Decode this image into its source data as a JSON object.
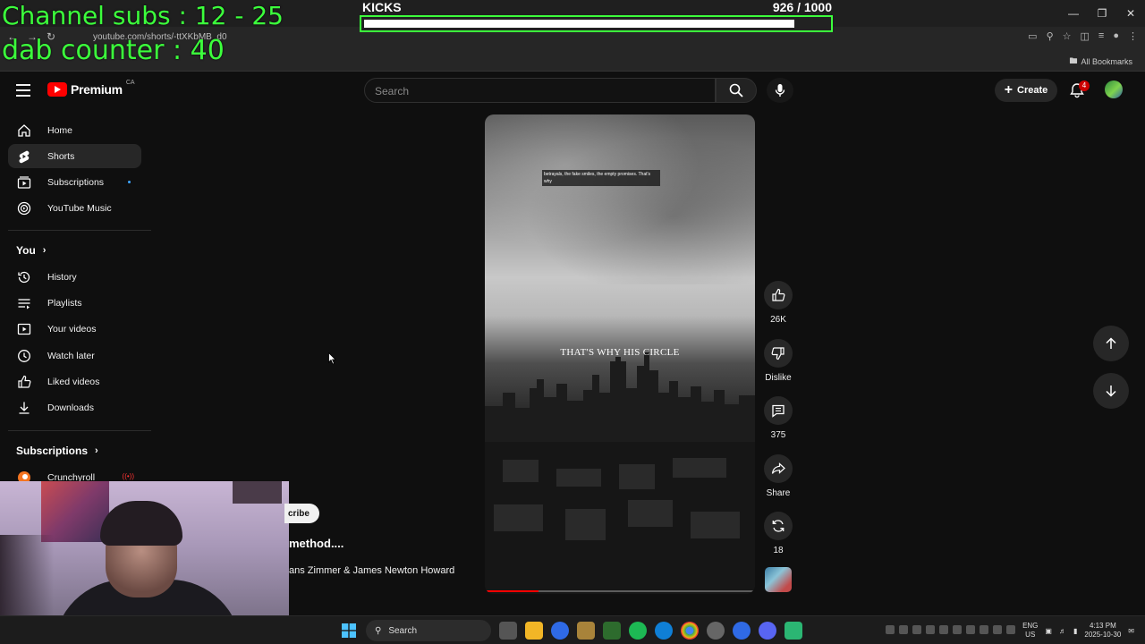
{
  "overlay": {
    "channel_subs": "Channel subs : 12 - 25",
    "dab_counter": "dab counter : 40",
    "kicks_label": "KICKS",
    "kicks_count": "926  / 1000",
    "kicks_progress": 0.926
  },
  "browser": {
    "url": "youtube.com/shorts/-ttXKbMB_d0",
    "bookmarks_label": "All Bookmarks"
  },
  "header": {
    "logo_text": "Premium",
    "region": "CA",
    "search_placeholder": "Search",
    "create_label": "Create",
    "notification_count": "4"
  },
  "sidebar": {
    "main": [
      {
        "label": "Home",
        "icon": "home-icon"
      },
      {
        "label": "Shorts",
        "icon": "shorts-icon",
        "active": true
      },
      {
        "label": "Subscriptions",
        "icon": "subscriptions-icon",
        "dot": true
      },
      {
        "label": "YouTube Music",
        "icon": "youtube-music-icon"
      }
    ],
    "you_heading": "You",
    "you": [
      {
        "label": "History",
        "icon": "history-icon"
      },
      {
        "label": "Playlists",
        "icon": "playlists-icon"
      },
      {
        "label": "Your videos",
        "icon": "your-videos-icon"
      },
      {
        "label": "Watch later",
        "icon": "watch-later-icon"
      },
      {
        "label": "Liked videos",
        "icon": "liked-videos-icon"
      },
      {
        "label": "Downloads",
        "icon": "downloads-icon"
      }
    ],
    "subscriptions_heading": "Subscriptions",
    "subscriptions": [
      {
        "label": "Crunchyroll",
        "icon": "crunchyroll-icon"
      }
    ]
  },
  "short": {
    "caption": "betrayals, the fake smiles, the empty promises. That's why",
    "overlay_text": "THAT'S WHY HIS CIRCLE",
    "subscribe_label": "cribe",
    "title": "method....",
    "music": "ans Zimmer & James Newton Howard",
    "progress": 0.2
  },
  "actions": {
    "likes": "26K",
    "dislike_label": "Dislike",
    "comments": "375",
    "share_label": "Share",
    "remix_count": "18"
  },
  "taskbar": {
    "search_label": "Search",
    "lang": "ENG",
    "region": "US",
    "time": "4:13 PM",
    "date": "2025-10-30"
  }
}
